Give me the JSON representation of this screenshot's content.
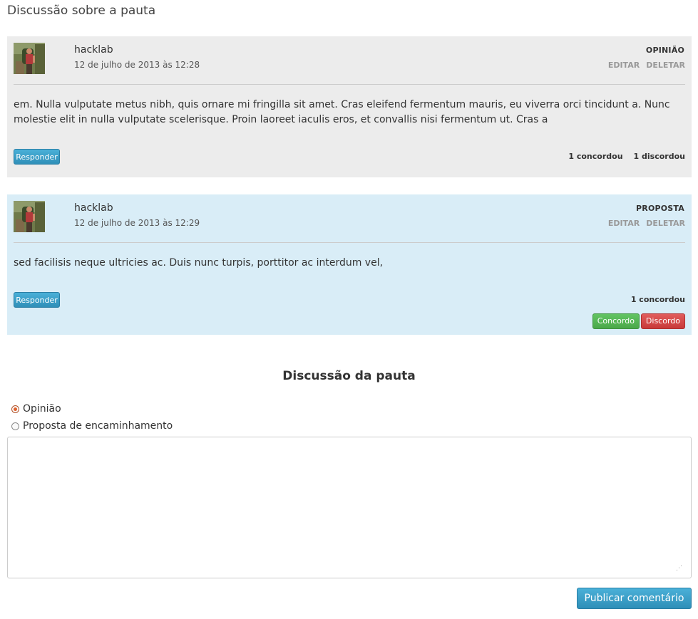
{
  "page": {
    "title": "Discussão sobre a pauta"
  },
  "comments": [
    {
      "author": "hacklab",
      "date": "12 de julho de 2013 às 12:28",
      "type": "OPINIÃO",
      "edit_label": "EDITAR",
      "delete_label": "DELETAR",
      "text": "em. Nulla vulputate metus nibh, quis ornare mi fringilla sit amet. Cras eleifend fermentum mauris, eu viverra orci tincidunt a. Nunc molestie elit in nulla vulputate scelerisque. Proin laoreet iaculis eros, et convallis nisi fermentum ut. Cras a",
      "reply_label": "Responder",
      "agree_count": "1 concordou",
      "disagree_count": "1 discordou",
      "background": "#ececec"
    },
    {
      "author": "hacklab",
      "date": "12 de julho de 2013 às 12:29",
      "type": "PROPOSTA",
      "edit_label": "EDITAR",
      "delete_label": "DELETAR",
      "text": "sed facilisis neque ultricies ac. Duis nunc turpis, porttitor ac interdum vel,",
      "reply_label": "Responder",
      "agree_count": "1 concordou",
      "agree_button": "Concordo",
      "disagree_button": "Discordo",
      "background": "#d9edf7"
    }
  ],
  "form": {
    "heading": "Discussão da pauta",
    "options": [
      {
        "label": "Opinião",
        "checked": true
      },
      {
        "label": "Proposta de encaminhamento",
        "checked": false
      }
    ],
    "textarea_value": "",
    "submit_label": "Publicar comentário"
  },
  "colors": {
    "primary_button": "#2f8fb8",
    "agree_button": "#4aa84a",
    "disagree_button": "#c83a3a",
    "radio_accent": "#e0612c"
  }
}
